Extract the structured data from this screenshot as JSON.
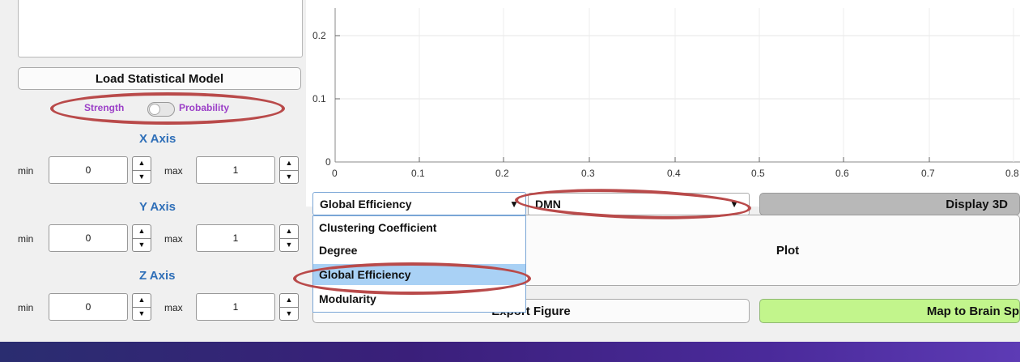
{
  "left_panel": {
    "load_button": "Load Statistical Model",
    "toggle": {
      "left": "Strength",
      "right": "Probability"
    },
    "x_axis": {
      "title": "X Axis",
      "min_label": "min",
      "min_value": "0",
      "max_label": "max",
      "max_value": "1"
    },
    "y_axis": {
      "title": "Y Axis",
      "min_label": "min",
      "min_value": "0",
      "max_label": "max",
      "max_value": "1"
    },
    "z_axis": {
      "title": "Z Axis",
      "min_label": "min",
      "min_value": "0",
      "max_label": "max",
      "max_value": "1"
    }
  },
  "plot_area": {
    "y_ticks": [
      "0.2",
      "0.1",
      "0"
    ],
    "x_ticks": [
      "0",
      "0.1",
      "0.2",
      "0.3",
      "0.4",
      "0.5",
      "0.6",
      "0.7",
      "0.8"
    ]
  },
  "controls": {
    "metric_select": {
      "value": "Global Efficiency",
      "options": [
        "Clustering Coefficient",
        "Degree",
        "Global Efficiency",
        "Modularity"
      ],
      "highlighted": "Global Efficiency"
    },
    "network_select": {
      "value": "DMN"
    },
    "display_3d_button": "Display 3D",
    "plot_button": "Plot",
    "export_button": "Export Figure",
    "map_button": "Map to Brain Sp"
  },
  "colors": {
    "accent_purple": "#9b3fc7",
    "axis_blue": "#2f6fb8",
    "annotation_red": "#b94a4a",
    "map_green": "#c2f58c",
    "selection_blue": "#a9d1f5"
  }
}
